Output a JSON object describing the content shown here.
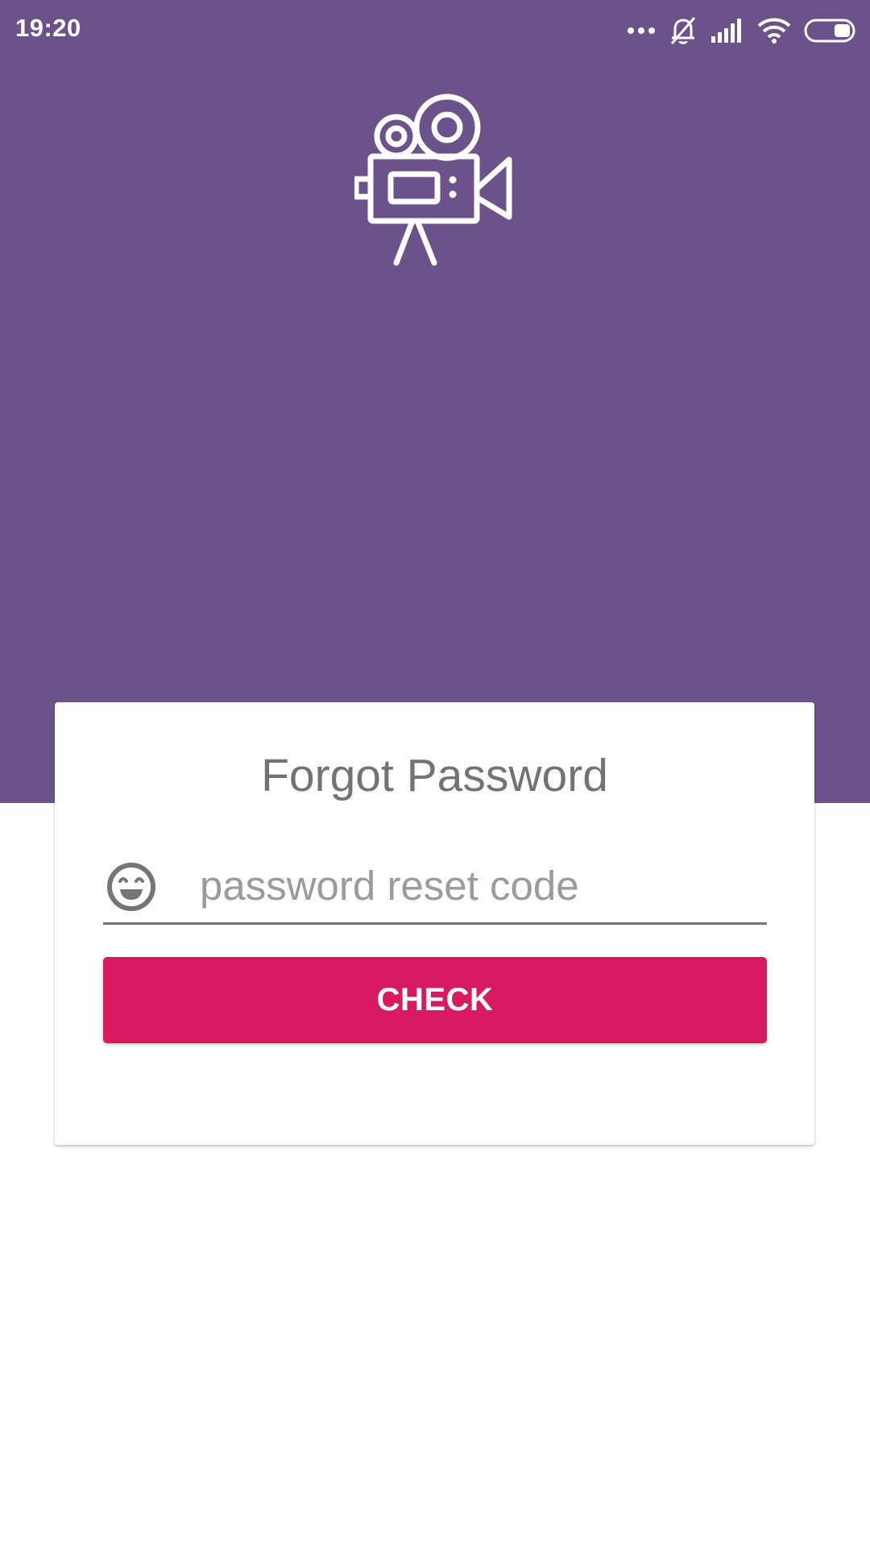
{
  "status_bar": {
    "time": "19:20",
    "icons": [
      "more-dots-icon",
      "bell-off-icon",
      "cellular-signal-icon",
      "wifi-icon",
      "battery-icon"
    ]
  },
  "header": {
    "logo_icon": "movie-camera-icon",
    "background_color": "#6c528a"
  },
  "form": {
    "title": "Forgot Password",
    "code_field": {
      "icon": "smiley-face-icon",
      "placeholder": "password reset code",
      "value": ""
    },
    "submit_label": "CHECK",
    "submit_color": "#d81b60"
  }
}
